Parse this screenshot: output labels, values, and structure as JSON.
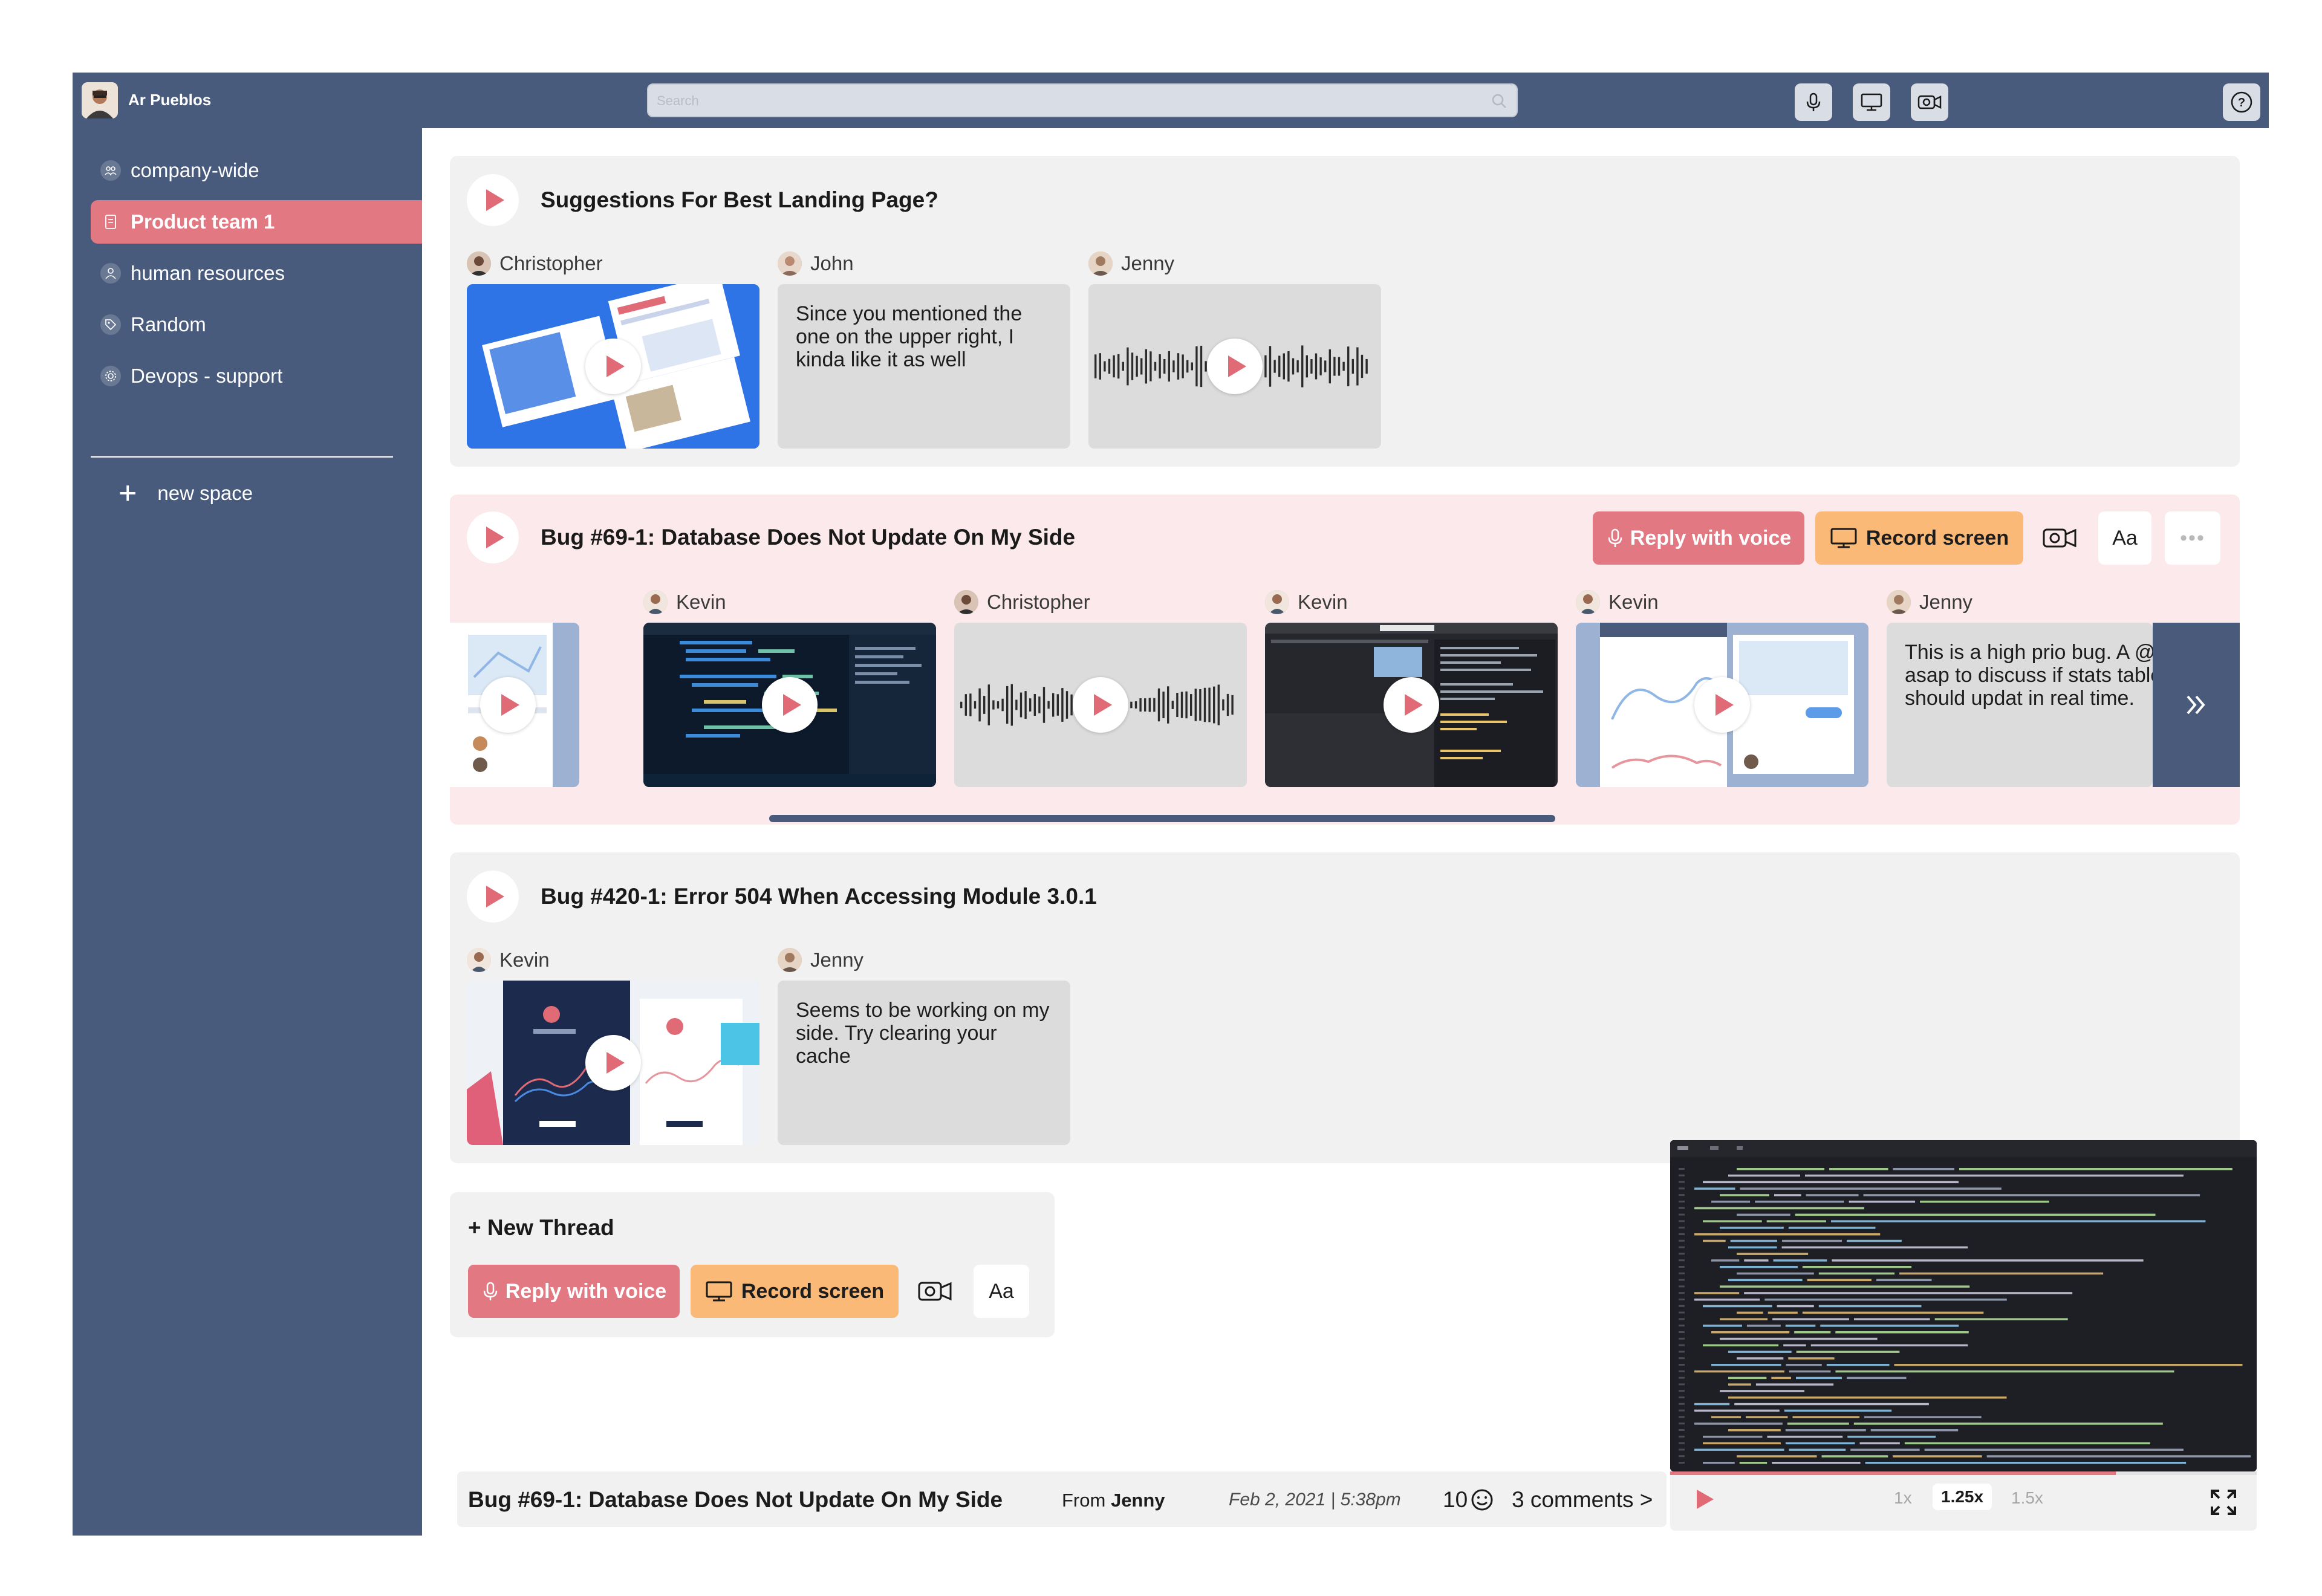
{
  "user": {
    "name": "Ar Pueblos"
  },
  "search": {
    "placeholder": "Search"
  },
  "sidebar": {
    "items": [
      {
        "label": "company-wide",
        "icon": "group-icon"
      },
      {
        "label": "Product team 1",
        "icon": "document-icon",
        "active": true
      },
      {
        "label": "human resources",
        "icon": "person-icon"
      },
      {
        "label": "Random",
        "icon": "tag-icon"
      },
      {
        "label": "Devops - support",
        "icon": "gear-icon"
      }
    ],
    "new_space": "new space"
  },
  "threads": [
    {
      "title": "Suggestions For Best Landing Page?",
      "messages": [
        {
          "author": "Christopher",
          "kind": "video"
        },
        {
          "author": "John",
          "kind": "text",
          "text": "Since you mentioned the one on the upper right, I kinda like it as well"
        },
        {
          "author": "Jenny",
          "kind": "audio"
        }
      ]
    },
    {
      "title": "Bug #69-1: Database Does Not Update On My Side",
      "actions": {
        "voice": "Reply with voice",
        "screen": "Record screen",
        "text": "Aa",
        "more": "•••"
      },
      "messages": [
        {
          "author": "Kevin",
          "kind": "video"
        },
        {
          "author": "Christopher",
          "kind": "audio"
        },
        {
          "author": "Kevin",
          "kind": "video"
        },
        {
          "author": "Kevin",
          "kind": "video"
        },
        {
          "author": "Jenny",
          "kind": "text",
          "text": "This is a high prio bug. A @john asap to discuss if stats table should updat in real time."
        }
      ]
    },
    {
      "title": "Bug #420-1: Error 504 When Accessing Module 3.0.1",
      "messages": [
        {
          "author": "Kevin",
          "kind": "video"
        },
        {
          "author": "Jenny",
          "kind": "text",
          "text": "Seems to be working on my side. Try clearing your cache"
        }
      ]
    }
  ],
  "new_thread": {
    "title": "+ New Thread",
    "voice": "Reply with voice",
    "screen": "Record screen",
    "text": "Aa"
  },
  "footer": {
    "title": "Bug #69-1: Database Does Not Update On My Side",
    "from_label": "From",
    "from_name": "Jenny",
    "date": "Feb 2, 2021 | 5:38pm",
    "reactions": "10",
    "comments": "3 comments >"
  },
  "player": {
    "speeds": [
      "1x",
      "1.25x",
      "1.5x"
    ],
    "selected_speed": "1.25x",
    "progress": 0.76
  },
  "colors": {
    "brand": "#495b7c",
    "accent_pink": "#e27882",
    "accent_orange": "#fbb978",
    "confirm": "#2f7d4b",
    "cancel": "#d6363c"
  }
}
